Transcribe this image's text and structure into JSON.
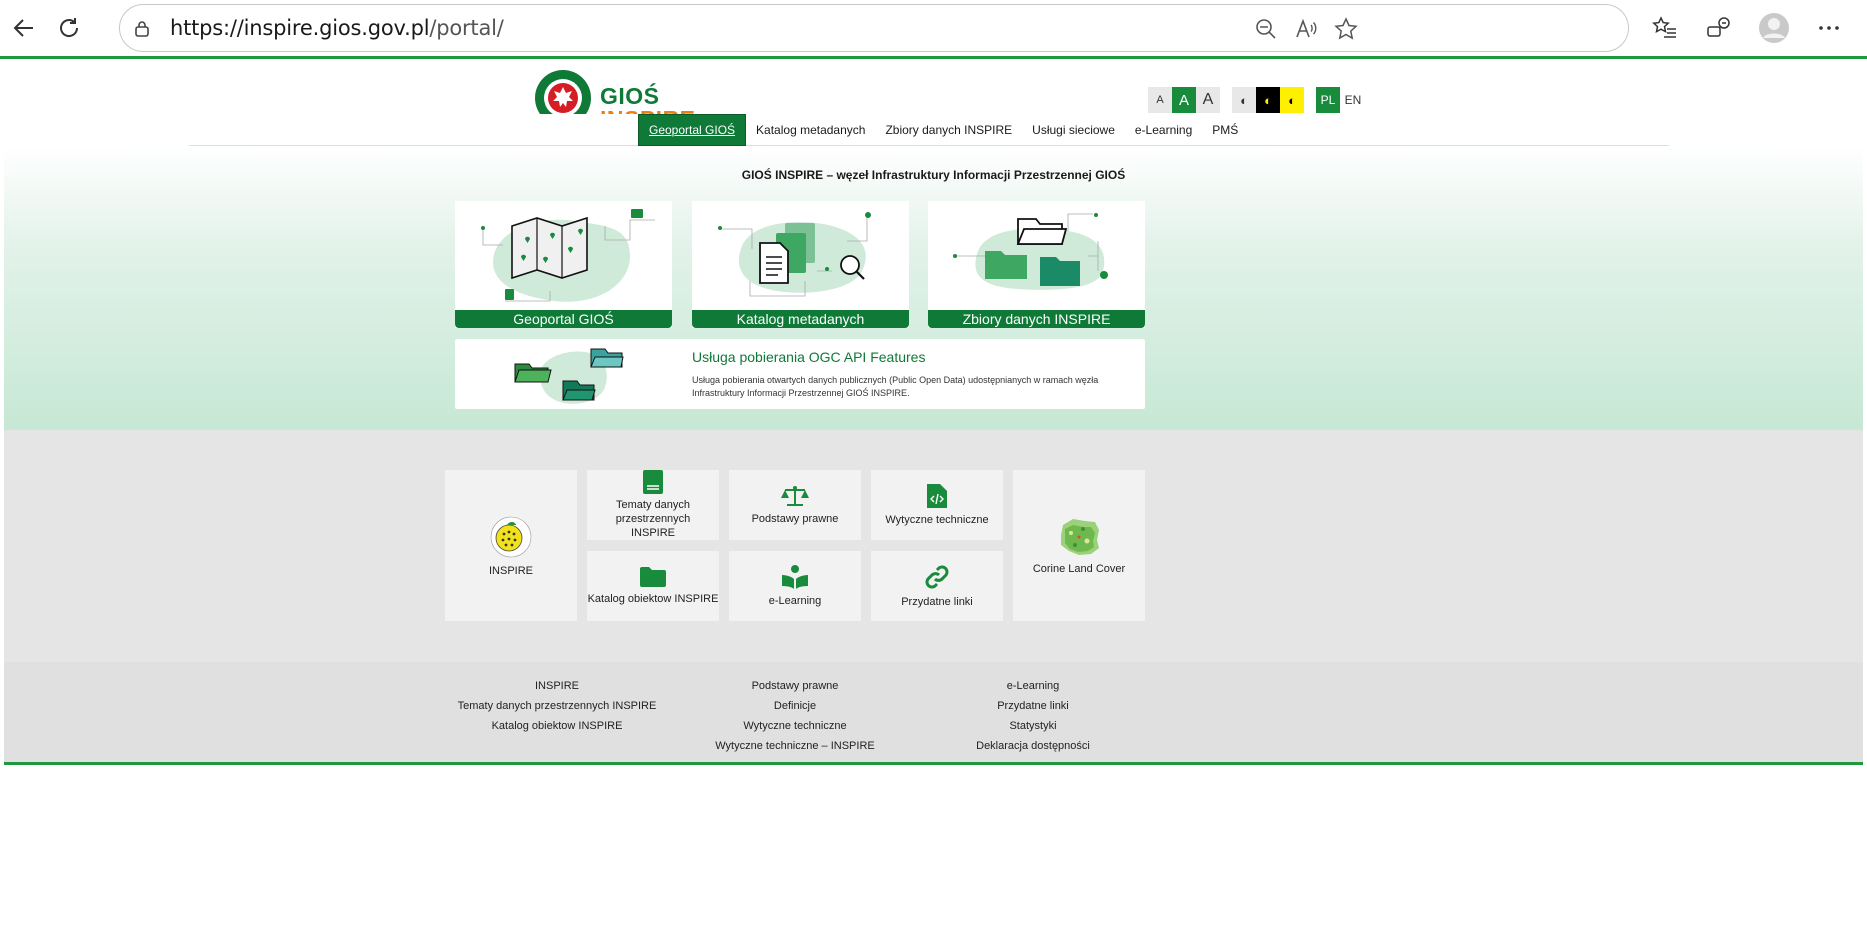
{
  "browser": {
    "url_host": "https://inspire.gios.gov.pl",
    "url_path": "/portal/"
  },
  "logo": {
    "line1": "GIOŚ",
    "line2": "INSPIRE"
  },
  "accessibility": {
    "font_small": "A",
    "font_medium": "A",
    "font_large": "A",
    "contrast_normal": "◐",
    "contrast_black": "◐",
    "contrast_yellow": "◐",
    "lang_pl": "PL",
    "lang_en": "EN"
  },
  "nav": {
    "items": [
      {
        "label": "Geoportal GIOŚ",
        "active": true
      },
      {
        "label": "Katalog metadanych"
      },
      {
        "label": "Zbiory danych INSPIRE"
      },
      {
        "label": "Usługi sieciowe"
      },
      {
        "label": "e-Learning"
      },
      {
        "label": "PMŚ"
      }
    ]
  },
  "hero": {
    "title": "GIOŚ INSPIRE – węzeł Infrastruktury Informacji Przestrzennej GIOŚ",
    "cards": [
      {
        "label": "Geoportal GIOŚ",
        "icon": "map-icon"
      },
      {
        "label": "Katalog metadanych",
        "icon": "document-search-icon"
      },
      {
        "label": "Zbiory danych INSPIRE",
        "icon": "folders-icon"
      }
    ],
    "feature": {
      "title": "Usługa pobierania OGC API Features",
      "description": "Usługa pobierania otwartych danych publicznych (Public Open Data) udostępnianych w ramach węzła Infrastruktury Informacji Przestrzennej GIOŚ INSPIRE."
    }
  },
  "tiles": {
    "inspire": "INSPIRE",
    "tematy": "Tematy danych przestrzennych INSPIRE",
    "podstawy": "Podstawy prawne",
    "wytyczne": "Wytyczne techniczne",
    "katalog": "Katalog obiektow INSPIRE",
    "elearning": "e-Learning",
    "linki": "Przydatne linki",
    "corine": "Corine Land Cover"
  },
  "footer": {
    "col1": [
      "INSPIRE",
      "Tematy danych przestrzennych INSPIRE",
      "Katalog obiektow INSPIRE"
    ],
    "col2": [
      "Podstawy prawne",
      "Definicje",
      "Wytyczne techniczne",
      "Wytyczne techniczne – INSPIRE"
    ],
    "col3": [
      "e-Learning",
      "Przydatne linki",
      "Statystyki",
      "Deklaracja dostępności"
    ]
  },
  "colors": {
    "brand_green": "#0f7a37",
    "brand_orange": "#f07d10",
    "accent_green": "#1e9a3e"
  }
}
